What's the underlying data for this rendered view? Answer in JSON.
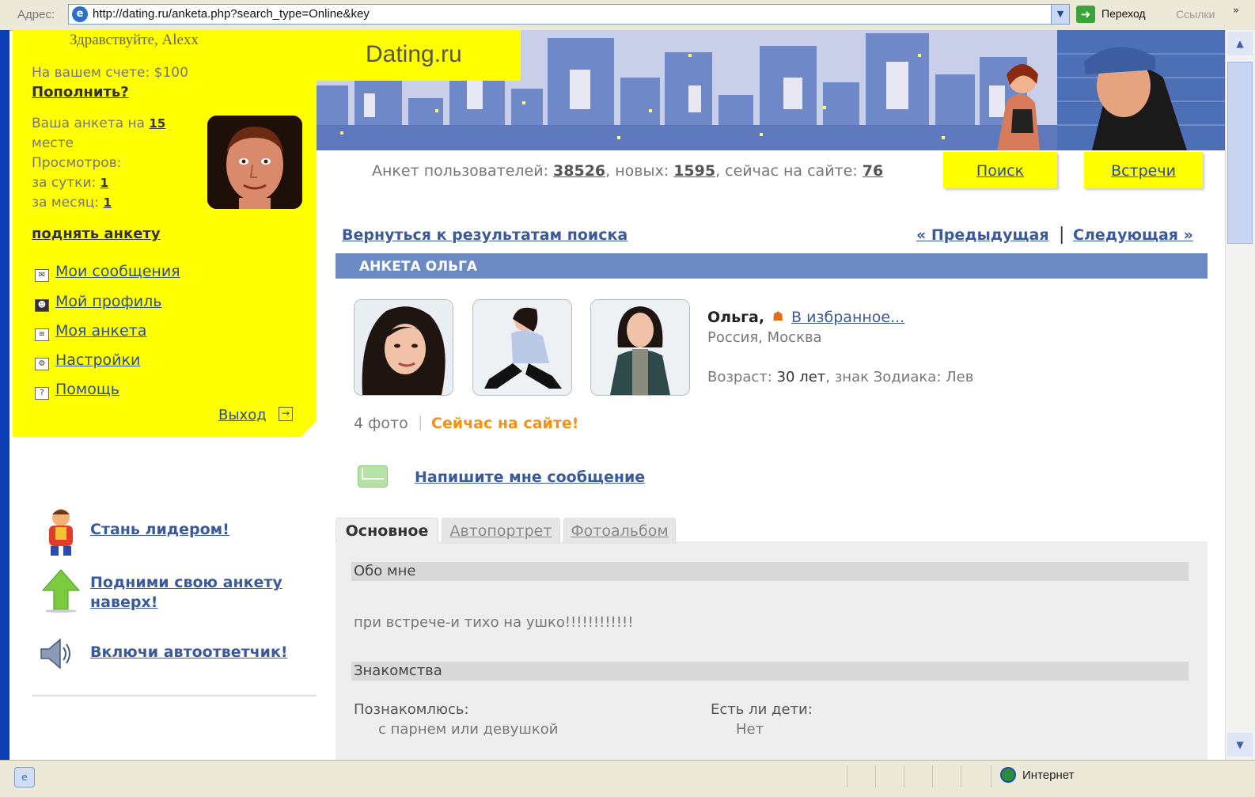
{
  "browser": {
    "address_label": "Адрес:",
    "url": "http://dating.ru/anketa.php?search_type=Online&key",
    "go_label": "Переход",
    "links_label": "Ссылки",
    "links_more": "»",
    "status_zone": "Интернет"
  },
  "sidebar": {
    "greeting": "Здравствуйте, Alexx",
    "balance_text": "На вашем счете: $100",
    "topup_link": "Пополнить?",
    "rank_text": "Ваша анкета на",
    "rank_value": "15",
    "rank_suffix": "месте",
    "views_label": "Просмотров:",
    "views_day_label": "за сутки:",
    "views_day": "1",
    "views_month_label": "за месяц:",
    "views_month": "1",
    "raise_link": "поднять анкету",
    "menu": [
      {
        "label": "Мои сообщения",
        "icon": "mail-icon"
      },
      {
        "label": "Мой профиль",
        "icon": "profile-icon"
      },
      {
        "label": "Моя анкета",
        "icon": "form-icon"
      },
      {
        "label": "Настройки",
        "icon": "settings-icon"
      },
      {
        "label": "Помощь",
        "icon": "help-icon"
      }
    ],
    "logout": "Выход"
  },
  "promos": [
    {
      "label": "Стань лидером!",
      "icon": "leader-icon"
    },
    {
      "label": "Подними свою анкету наверх!",
      "icon": "arrow-up-icon"
    },
    {
      "label": "Включи автоответчик!",
      "icon": "speaker-icon"
    }
  ],
  "header": {
    "logo": "Dating.ru",
    "stats_prefix": "Анкет пользователей:",
    "total": "38526",
    "new_label": ", новых:",
    "new": "1595",
    "online_label": ", сейчас на сайте:",
    "online": "76",
    "search_btn": "Поиск",
    "meetings_btn": "Встречи"
  },
  "nav": {
    "back": "Вернуться к результатам поиска",
    "prev": "« Предыдущая",
    "sep": "|",
    "next": "Следующая »"
  },
  "profile": {
    "title": "АНКЕТА ОЛЬГА",
    "name": "Ольга,",
    "favorite": "В избранное...",
    "location": "Россия, Москва",
    "age_label": "Возраст:",
    "age": "30 лет",
    "zodiac_label": ", знак Зодиака:",
    "zodiac": "Лев",
    "photo_count": "4 фото",
    "sep": "|",
    "online_status": "Сейчас на сайте!",
    "write_message": "Напишите мне сообщение"
  },
  "tabs": [
    "Основное",
    "Автопортрет",
    "Фотоальбом"
  ],
  "sections": {
    "about_title": "Обо мне",
    "about_text": "при встрече-и тихо на ушко!!!!!!!!!!!!",
    "dating_title": "Знакомства",
    "seeking_label": "Познакомлюсь:",
    "seeking_value": "с парнем или девушкой",
    "children_label": "Есть ли дети:",
    "children_value": "Нет"
  },
  "colors": {
    "accent_yellow": "#ffff00",
    "link_blue": "#3a5a9a",
    "title_bar": "#6b8ac4",
    "online_orange": "#f29118"
  }
}
